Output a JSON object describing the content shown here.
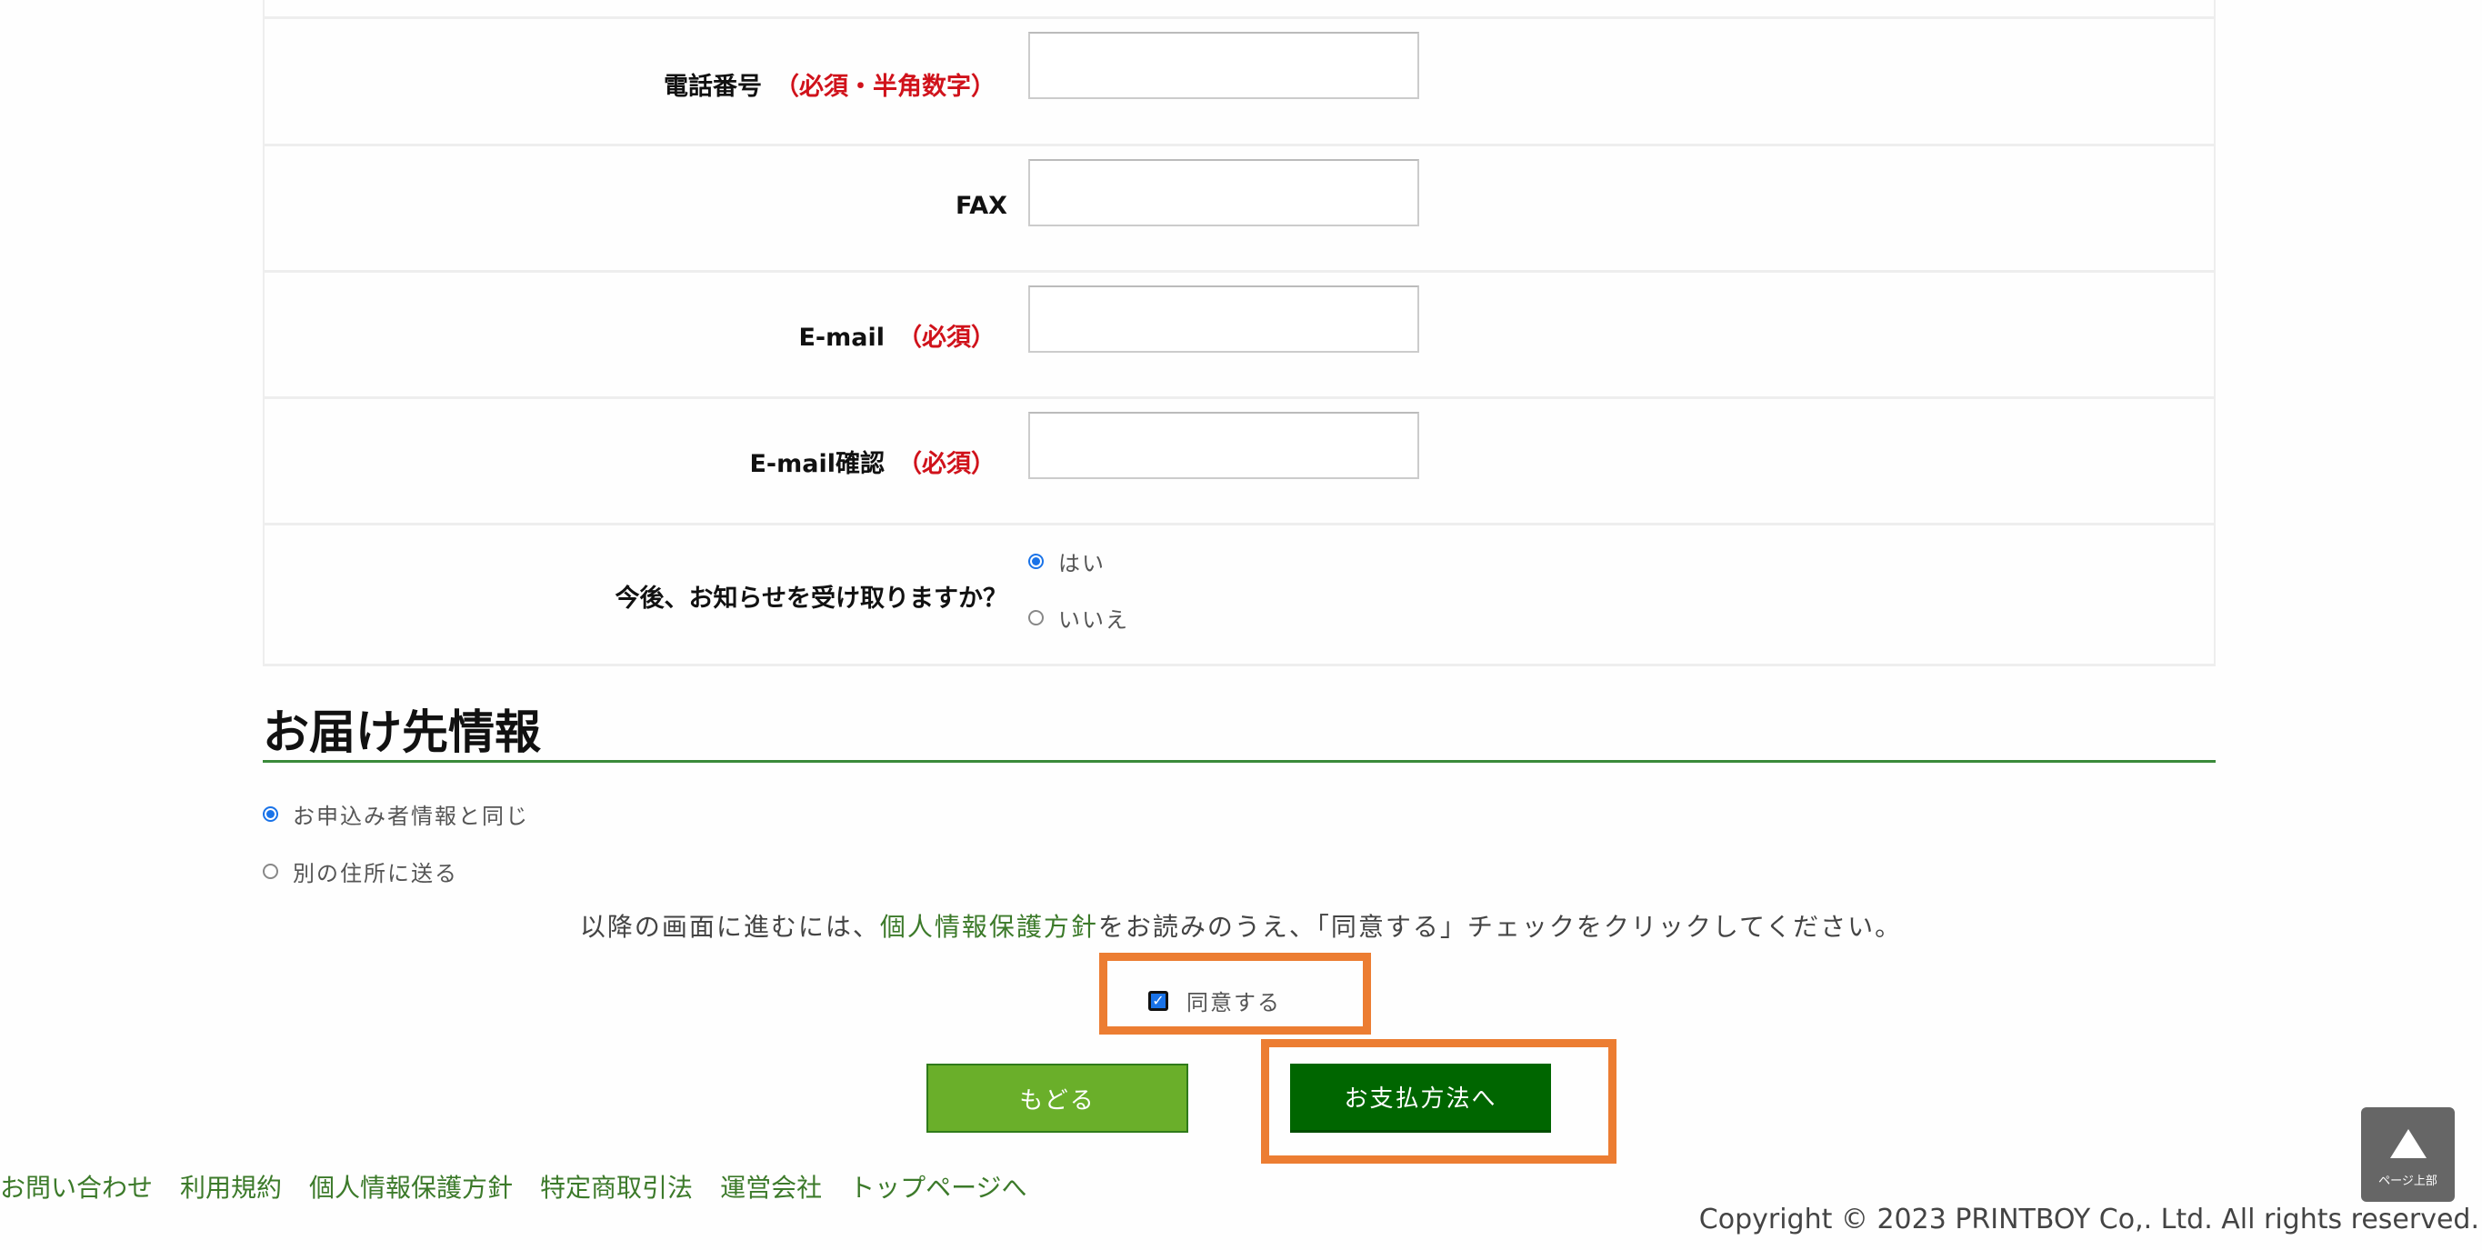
{
  "form": {
    "rows": [
      {
        "label": "電話番号",
        "required": "（必須・半角数字）",
        "value": ""
      },
      {
        "label": "FAX",
        "required": "",
        "value": ""
      },
      {
        "label": "E-mail",
        "required": "（必須）",
        "value": ""
      },
      {
        "label": "E-mail確認",
        "required": "（必須）",
        "value": ""
      }
    ],
    "newsletter": {
      "label": "今後、お知らせを受け取りますか？",
      "options": [
        {
          "label": "はい",
          "selected": true
        },
        {
          "label": "いいえ",
          "selected": false
        }
      ]
    }
  },
  "delivery": {
    "heading": "お届け先情報",
    "options": [
      {
        "label": "お申込み者情報と同じ",
        "selected": true
      },
      {
        "label": "別の住所に送る",
        "selected": false
      }
    ]
  },
  "consent": {
    "notice_before": "以降の画面に進むには、",
    "notice_link": "個人情報保護方針",
    "notice_after": "をお読みのうえ、「同意する」チェックをクリックしてください。",
    "checkbox_label": "同意する",
    "checked": true
  },
  "buttons": {
    "back": "もどる",
    "next": "お支払方法へ"
  },
  "highlight_color": "#ec7d32",
  "footer": {
    "links": [
      "お問い合わせ",
      "利用規約",
      "個人情報保護方針",
      "特定商取引法",
      "運営会社",
      "トップページへ"
    ],
    "copyright": "Copyright © 2023 PRINTBOY Co,. Ltd. All rights reserved.",
    "page_top_label": "ページ上部"
  }
}
